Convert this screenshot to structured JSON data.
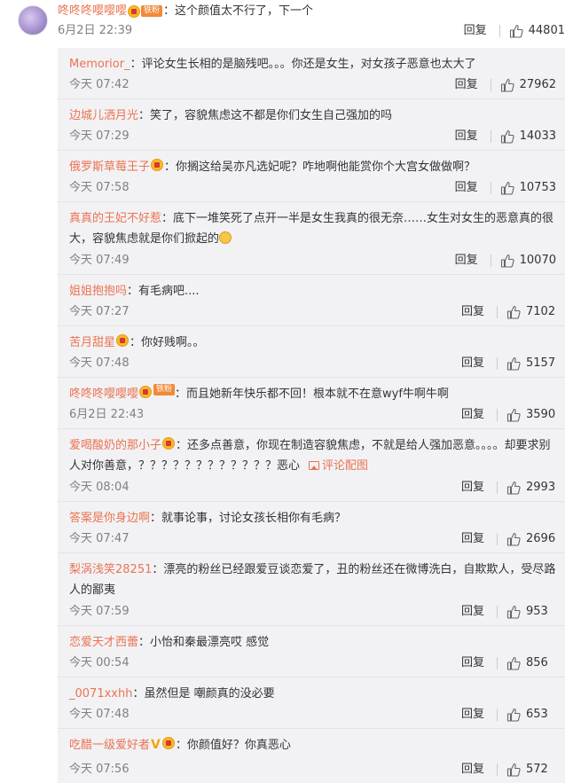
{
  "main_comment": {
    "username": "咚咚咚嘤嘤嘤",
    "member_tag": "铁粉",
    "content": "：这个颜值太不行了，下一个",
    "time": "6月2日 22:39",
    "reply_label": "回复",
    "likes": "44801"
  },
  "replies": [
    {
      "username": "Memorior_",
      "badges": [],
      "content": "：评论女生长相的是脑残吧。。。你还是女生，对女孩子恶意也太大了",
      "time": "今天 07:42",
      "reply_label": "回复",
      "likes": "27962"
    },
    {
      "username": "边城儿洒月光",
      "badges": [],
      "content": "：笑了，容貌焦虑这不都是你们女生自己强加的吗",
      "time": "今天 07:29",
      "reply_label": "回复",
      "likes": "14033"
    },
    {
      "username": "俄罗斯草莓王子",
      "badges": [
        "crown"
      ],
      "content": "：你搁这给吴亦凡选妃呢？咋地啊他能赏你个大宫女做做啊？",
      "time": "今天 07:58",
      "reply_label": "回复",
      "likes": "10753"
    },
    {
      "username": "真真的王妃不好惹",
      "badges": [],
      "content": "：底下一堆笑死了点开一半是女生我真的很无奈……女生对女生的恶意真的很大，容貌焦虑就是你们掀起的",
      "time": "今天 07:49",
      "reply_label": "回复",
      "likes": "10070"
    },
    {
      "username": "姐姐抱抱吗",
      "badges": [],
      "content": "：有毛病吧....",
      "time": "今天 07:27",
      "reply_label": "回复",
      "likes": "7102"
    },
    {
      "username": "苦月甜星",
      "badges": [
        "crown"
      ],
      "content": "：你好贱啊。。",
      "time": "今天 07:48",
      "reply_label": "回复",
      "likes": "5157"
    },
    {
      "username": "咚咚咚嘤嘤嘤",
      "badges": [
        "crown",
        "tag"
      ],
      "tag_text": "铁粉",
      "content": "：而且她新年快乐都不回！根本就不在意wyf牛啊牛啊",
      "time": "6月2日 22:43",
      "reply_label": "回复",
      "likes": "3590"
    },
    {
      "username": "爱喝酸奶的那小子",
      "badges": [
        "crown"
      ],
      "content": "：还多点善意，你现在制造容貌焦虑，不就是给人强加恶意。。。。却要求别人对你善意，？？？？？？？？？？？？恶心",
      "pic_link": "评论配图",
      "time": "今天 08:04",
      "reply_label": "回复",
      "likes": "2993"
    },
    {
      "username": "答案是你身边啊",
      "badges": [],
      "content": "：就事论事，讨论女孩长相你有毛病？",
      "time": "今天 07:47",
      "reply_label": "回复",
      "likes": "2696"
    },
    {
      "username": "梨涡浅笑28251",
      "badges": [],
      "content": "：漂亮的粉丝已经跟爱豆谈恋爱了，丑的粉丝还在微博洗白，自欺欺人，受尽路人的鄙夷",
      "time": "今天 07:59",
      "reply_label": "回复",
      "likes": "953"
    },
    {
      "username": "恋爱天才西蕾",
      "badges": [],
      "content": "：小怡和秦最漂亮哎 感觉",
      "time": "今天 00:54",
      "reply_label": "回复",
      "likes": "856"
    },
    {
      "username": "_0071xxhh",
      "badges": [],
      "content": "：虽然但是 嘲颜真的没必要",
      "time": "今天 07:48",
      "reply_label": "回复",
      "likes": "653"
    },
    {
      "username": "吃醋一级爱好者",
      "badges": [
        "v",
        "crown"
      ],
      "content": "：你颜值好？你真恶心",
      "time": "今天 07:56",
      "reply_label": "回复",
      "likes": "572"
    }
  ],
  "colors": {
    "username": "#eb7350",
    "text": "#333333",
    "meta": "#808080",
    "panel": "#f2f2f5"
  },
  "icons": {
    "like": "thumbs-up-icon",
    "badge": "crown-badge-icon",
    "pic": "picture-icon"
  }
}
